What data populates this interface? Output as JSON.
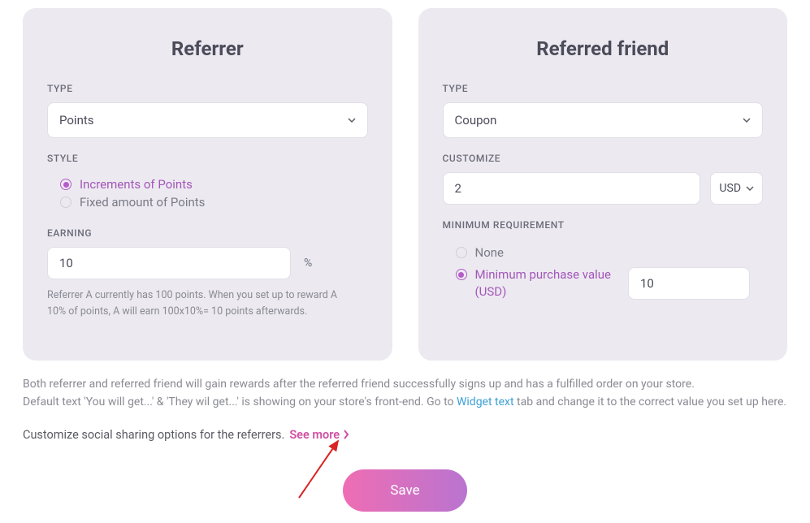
{
  "referrer": {
    "title": "Referrer",
    "type_label": "TYPE",
    "type_value": "Points",
    "style_label": "STYLE",
    "style_options": [
      {
        "label": "Increments of Points",
        "checked": true
      },
      {
        "label": "Fixed amount of Points",
        "checked": false
      }
    ],
    "earning_label": "EARNING",
    "earning_value": "10",
    "earning_unit": "%",
    "helper_text": "Referrer A currently has 100 points. When you set up to reward A 10% of points, A will earn 100x10%= 10 points afterwards."
  },
  "referred": {
    "title": "Referred friend",
    "type_label": "TYPE",
    "type_value": "Coupon",
    "customize_label": "CUSTOMIZE",
    "customize_value": "2",
    "currency": "USD",
    "minreq_label": "MINIMUM REQUIREMENT",
    "minreq_options": {
      "none_label": "None",
      "minpurchase_label": "Minimum purchase value (USD)"
    },
    "minreq_selected": "minpurchase",
    "minreq_value": "10"
  },
  "notes": {
    "line1": "Both referrer and referred friend will gain rewards after the referred friend successfully signs up and has a fulfilled order on your store.",
    "line2_a": "Default text 'You will get...' & 'They wil get...' is showing on your store's front-end. Go to ",
    "line2_link": "Widget text",
    "line2_b": " tab and change it to the correct value you set up here."
  },
  "share": {
    "text": "Customize social sharing options for the referrers.",
    "see_more": "See more"
  },
  "actions": {
    "save": "Save"
  },
  "colors": {
    "accent": "#b55cc9",
    "pink": "#d04fa2",
    "link": "#3b9fd6"
  }
}
